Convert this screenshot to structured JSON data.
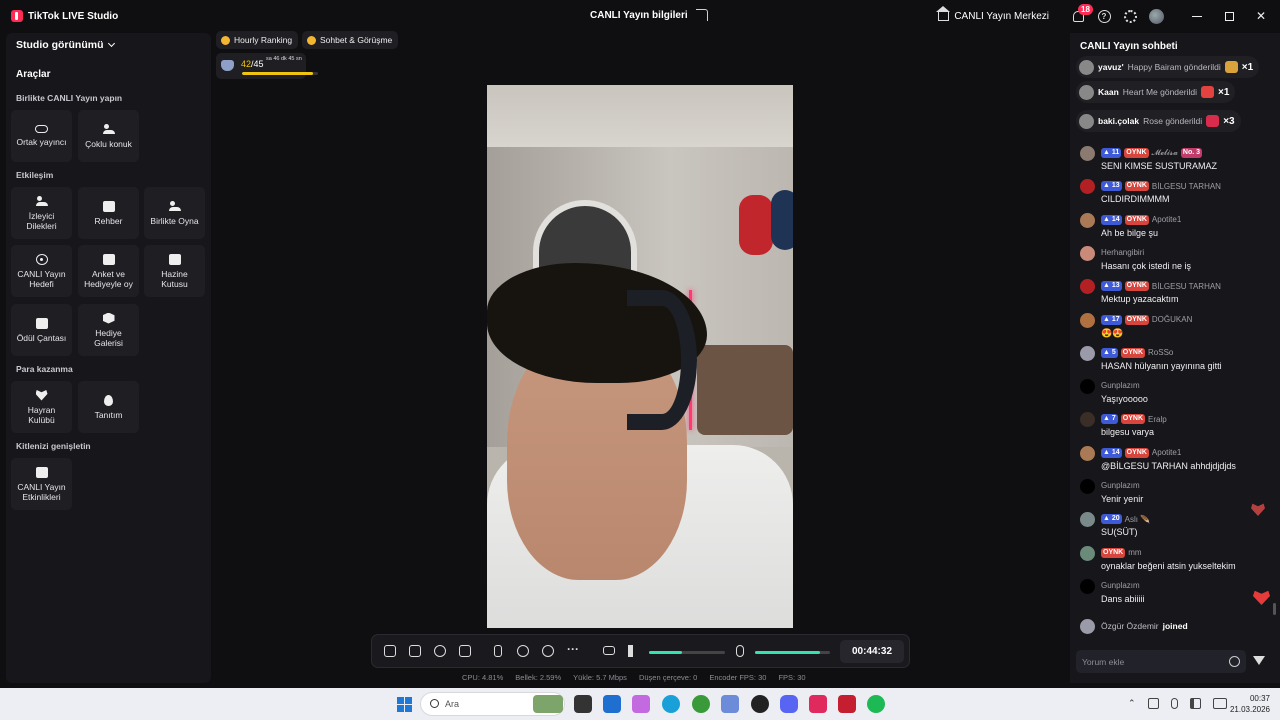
{
  "app": {
    "title": "TikTok LIVE Studio",
    "center_title": "CANLI Yayın bilgileri",
    "home_link": "CANLI Yayın Merkezi",
    "notification_count": "18",
    "help_symbol": "?",
    "accent": "#fe2c55"
  },
  "left": {
    "studio_view": "Studio görünümü",
    "tools_heading": "Araçlar",
    "sections": {
      "collab": "Birlikte CANLI Yayın yapın",
      "engagement": "Etkileşim",
      "monetize": "Para kazanma",
      "grow": "Kitlenizi genişletin"
    },
    "tiles": {
      "co_host": "Ortak yayıncı",
      "multi_guest": "Çoklu konuk",
      "viewer_wishes": "İzleyici Dilekleri",
      "guide": "Rehber",
      "play_together": "Birlikte Oyna",
      "live_goal": "CANLI Yayın Hedefi",
      "poll": "Anket ve Hediyeyle oy",
      "treasure": "Hazine Kutusu",
      "reward_bag": "Ödül Çantası",
      "gift_gallery": "Hediye Galerisi",
      "fan_club": "Hayran Kulübü",
      "promote": "Tanıtım",
      "live_events": "CANLI Yayın Etkinlikleri"
    }
  },
  "top_chips": {
    "hourly": "Hourly Ranking",
    "chat_meet": "Sohbet & Görüşme"
  },
  "ranking": {
    "current": "42",
    "total": "/45",
    "time_left": "sa 46 dk 45 sn",
    "progress": 0.93
  },
  "controls": {
    "timer": "00:44:32",
    "speaker_level": 0.43,
    "mic_level": 0.86,
    "more_symbol": "···"
  },
  "status": {
    "cpu": "CPU: 4.81%",
    "memory": "Bellek: 2.59%",
    "upload": "Yükle: 5.7 Mbps",
    "dropped": "Düşen çerçeve: 0",
    "encoder_fps": "Encoder FPS: 30",
    "fps": "FPS: 30"
  },
  "chat": {
    "title": "CANLI Yayın sohbeti",
    "gifts": [
      {
        "user": "yavuz'",
        "text": "Happy Bairam gönderildi",
        "count": "×1",
        "color": "#d9a23a"
      },
      {
        "user": "Kaan",
        "text": "Heart Me gönderildi",
        "count": "×1",
        "color": "#e2433f"
      },
      {
        "user": "baki.çolak",
        "text": "Rose gönderildi",
        "count": "×3",
        "color": "#d92c4d"
      }
    ],
    "messages": [
      {
        "lvl": "11",
        "fan": "OYNK",
        "user": "𝓜𝓮𝓵𝓲𝓼𝓪",
        "rank": "No. 3",
        "text": "SENI KIMSE SUSTURAMAZ",
        "av": "#8a7a70"
      },
      {
        "lvl": "13",
        "fan": "OYNK",
        "user": "BİLGESU TARHAN",
        "rank": "",
        "text": "CILDIRDIMMMM",
        "av": "#b32024"
      },
      {
        "lvl": "14",
        "fan": "OYNK",
        "user": "Apotite1",
        "rank": "",
        "text": "Ah be bilge şu",
        "av": "#a97a55"
      },
      {
        "lvl": "",
        "fan": "",
        "user": "Herhangibiri",
        "rank": "",
        "text": "Hasanı çok istedi ne iş",
        "av": "#c98a7a"
      },
      {
        "lvl": "13",
        "fan": "OYNK",
        "user": "BİLGESU TARHAN",
        "rank": "",
        "text": "Mektup yazacaktım",
        "av": "#b32024"
      },
      {
        "lvl": "17",
        "fan": "OYNK",
        "user": "DOĞUKAN",
        "rank": "",
        "text": "😍😍",
        "av": "#b07040"
      },
      {
        "lvl": "5",
        "fan": "OYNK",
        "user": "RoSSo",
        "rank": "",
        "text": "HASAN hülyanın yayınına gitti",
        "av": "#9a9aa8"
      },
      {
        "lvl": "",
        "fan": "",
        "user": "Gunplazım",
        "rank": "",
        "text": "Yaşıyooooo",
        "av": "#000000"
      },
      {
        "lvl": "7",
        "fan": "OYNK",
        "user": "Eralp",
        "rank": "",
        "text": "bilgesu varya",
        "av": "#3a2e26"
      },
      {
        "lvl": "14",
        "fan": "OYNK",
        "user": "Apotite1",
        "rank": "",
        "text": "@BİLGESU TARHAN ahhdjdjdjds",
        "av": "#a97a55"
      },
      {
        "lvl": "",
        "fan": "",
        "user": "Gunplazım",
        "rank": "",
        "text": "Yenir yenir",
        "av": "#000000"
      },
      {
        "lvl": "20",
        "fan": "",
        "user": "Aslı 🪶",
        "rank": "",
        "text": "SU(SÜT)",
        "av": "#7a8a8a"
      },
      {
        "lvl": "",
        "fan": "OYNK",
        "user": "mm",
        "rank": "",
        "text": "oynaklar beğeni atsin yukseltekim",
        "av": "#6a8a7a"
      },
      {
        "lvl": "",
        "fan": "",
        "user": "Gunplazım",
        "rank": "",
        "text": "Dans abiiiii",
        "av": "#000000"
      }
    ],
    "join": {
      "user": "Özgür Özdemir",
      "action": "joined"
    },
    "comment_placeholder": "Yorum ekle"
  },
  "taskbar": {
    "search_placeholder": "Ara",
    "time": "00:37",
    "date": "21.03.2026"
  }
}
